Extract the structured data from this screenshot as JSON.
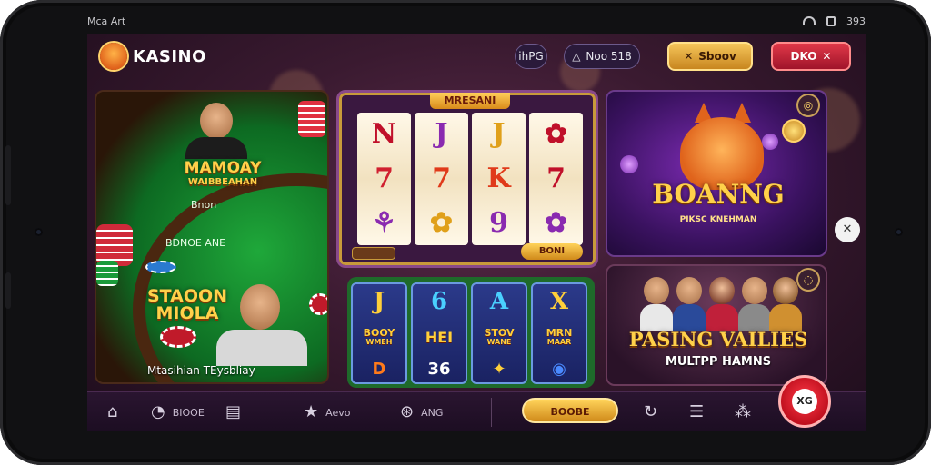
{
  "status_bar": {
    "left_text": "Mca Art",
    "right_text": "393"
  },
  "header": {
    "app_title": "KASINO",
    "pill_1": "ihPG",
    "pill_2": "Noo 518",
    "gold_button": "Sboov",
    "red_button": "DKO"
  },
  "poker_card": {
    "title_line_1": "MAMOAY",
    "title_line_2": "WAIBBEAHAN",
    "table_text_1": "Bnon",
    "table_text_2": "BDNOE ANE",
    "promo_line_1": "STAOON",
    "promo_line_2": "MIOLA",
    "caption": "Mtasihian TEysbliay"
  },
  "slot_machine": {
    "title": "MRESANI",
    "spin_button": "BONI",
    "reels": [
      [
        "N",
        "7",
        "⚘"
      ],
      [
        "J",
        "7",
        "✿"
      ],
      [
        "J",
        "K",
        "9"
      ],
      [
        "✿",
        "7",
        "✿"
      ]
    ]
  },
  "game_tiles": [
    {
      "top": "J",
      "mid_1": "BOOY",
      "mid_2": "WMEH",
      "bottom": "D",
      "top_color": "#ffcf3a",
      "bottom_color": "#ff7a1a"
    },
    {
      "top": "6",
      "mid_1": "HEI",
      "mid_2": "",
      "bottom": "36",
      "top_color": "#4ad0ff",
      "bottom_color": "#ffffff"
    },
    {
      "top": "A",
      "mid_1": "STOV",
      "mid_2": "WANE",
      "bottom": "✦",
      "top_color": "#4ad0ff",
      "bottom_color": "#ffcf3a"
    },
    {
      "top": "X",
      "mid_1": "MRN",
      "mid_2": "MAAR",
      "bottom": "◉",
      "top_color": "#ffcf3a",
      "bottom_color": "#4a8aff"
    }
  ],
  "fox_card": {
    "title": "BOANNG",
    "subtitle": "PIKSC KNEHMAN"
  },
  "group_card": {
    "title": "PASING VAILIES",
    "subtitle": "MULTPP HAMNS"
  },
  "bottom_nav": {
    "item_home": "",
    "item_chat": "BIOOE",
    "item_star": "Aevo",
    "item_planet": "ANG",
    "gold_button": "BOOBE",
    "fab_label": "XG"
  },
  "colors": {
    "accent_gold": "#f5c55a",
    "accent_red": "#d02a3a",
    "background": "#3a1a30"
  }
}
